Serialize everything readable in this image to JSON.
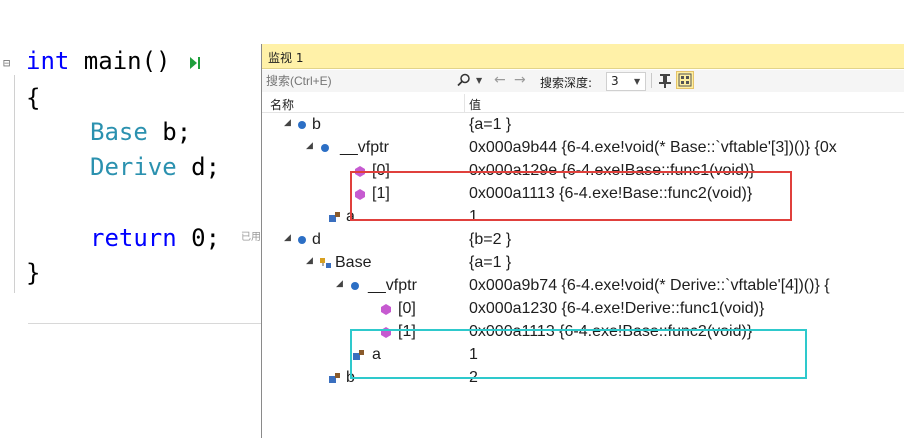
{
  "editor": {
    "line1": {
      "kw": "int",
      "rest": " main()"
    },
    "line2": "{",
    "line3": {
      "type": "Base",
      "rest": " b;"
    },
    "line4": {
      "type": "Derive",
      "rest": " d;"
    },
    "line5": {
      "kw": "return",
      "rest": " 0;"
    },
    "line6": "}",
    "hint": "已用"
  },
  "watch": {
    "title": "监视 1",
    "search": {
      "placeholder": "搜索(Ctrl+E)"
    },
    "depth_label": "搜索深度:",
    "depth_value": "3",
    "headers": {
      "name": "名称",
      "value": "值"
    },
    "rows": [
      {
        "name": "b",
        "value": "{a=1 }"
      },
      {
        "name": "__vfptr",
        "value": "0x000a9b44 {6-4.exe!void(* Base::`vftable'[3])()} {0x"
      },
      {
        "name": "[0]",
        "value": "0x000a129e {6-4.exe!Base::func1(void)}"
      },
      {
        "name": "[1]",
        "value": "0x000a1113 {6-4.exe!Base::func2(void)}"
      },
      {
        "name": "a",
        "value": "1"
      },
      {
        "name": "d",
        "value": "{b=2 }"
      },
      {
        "name": "Base",
        "value": "{a=1 }"
      },
      {
        "name": "__vfptr",
        "value": "0x000a9b74 {6-4.exe!void(* Derive::`vftable'[4])()} {"
      },
      {
        "name": "[0]",
        "value": "0x000a1230 {6-4.exe!Derive::func1(void)}"
      },
      {
        "name": "[1]",
        "value": "0x000a1113 {6-4.exe!Base::func2(void)}"
      },
      {
        "name": "a",
        "value": "1"
      },
      {
        "name": "b",
        "value": "2"
      }
    ]
  },
  "colors": {
    "keyword": "#0000ff",
    "type": "#2b91af",
    "highlight_red": "#e0403c",
    "highlight_cyan": "#2ec9cc",
    "title_bar": "#fff1a8"
  }
}
